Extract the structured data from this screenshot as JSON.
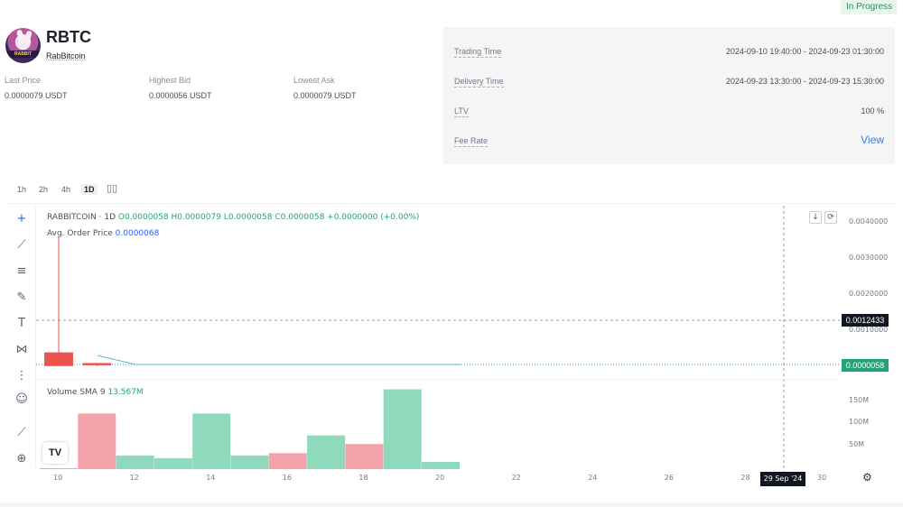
{
  "status": "In Progress",
  "token": {
    "symbol": "RBTC",
    "name": "RabBitcoin",
    "logo_icon": "rabbit-coin-logo",
    "logo_text": "RABBIT"
  },
  "stats": [
    {
      "label": "Last Price",
      "value": "0.0000079 USDT"
    },
    {
      "label": "Highest Bid",
      "value": "0.0000056 USDT"
    },
    {
      "label": "Lowest Ask",
      "value": "0.0000079 USDT"
    }
  ],
  "info": {
    "trading_time_label": "Trading Time",
    "trading_time_value": "2024-09-10 19:40:00 - 2024-09-23 01:30:00",
    "delivery_time_label": "Delivery Time",
    "delivery_time_value": "2024-09-23 13:30:00 - 2024-09-23 15:30:00",
    "ltv_label": "LTV",
    "ltv_value": "100 %",
    "fee_label": "Fee Rate",
    "fee_link": "View"
  },
  "timeframes": [
    "1h",
    "2h",
    "4h",
    "1D"
  ],
  "active_timeframe": "1D",
  "chart_type_icon": "candlestick-icon",
  "legend": {
    "symbol": "RABBITCOIN · 1D",
    "ohlc": "O0.0000058 H0.0000079 L0.0000058 C0.0000058 +0.0000000 (+0.00%)",
    "avg_label": "Avg. Order Price",
    "avg_value": "0.0000068",
    "volume_label": "Volume SMA 9",
    "volume_value": "13.567M"
  },
  "price_axis": [
    "0.0040000",
    "0.0030000",
    "0.0020000",
    "0.0010000"
  ],
  "crosshair_price": "0.0012433",
  "last_price_tag": "0.0000058",
  "volume_axis": [
    "150M",
    "100M",
    "50M"
  ],
  "date_axis": [
    "10",
    "12",
    "14",
    "16",
    "18",
    "20",
    "22",
    "24",
    "26",
    "28",
    "30"
  ],
  "crosshair_date": "29 Sep '24",
  "tv_logo": "TV",
  "colors": {
    "up": "#26a69a",
    "down": "#ef5350",
    "volume_up": "#8fd9bd",
    "volume_down": "#f5a3aa",
    "accent": "#3d7ce0"
  },
  "chart_data": {
    "type": "bar",
    "candles": [
      {
        "day": "2024-09-10",
        "open": 5.8e-06,
        "high": 0.004,
        "low": 5.8e-06,
        "close": 0.00043,
        "direction": "down"
      },
      {
        "day": "2024-09-11",
        "open": 0.0001,
        "high": 0.0001,
        "low": 7e-06,
        "close": 3e-05,
        "direction": "down"
      }
    ],
    "volume": {
      "categories": [
        "10",
        "11",
        "12",
        "13",
        "14",
        "15",
        "16",
        "17",
        "18",
        "19",
        "20"
      ],
      "values": [
        2,
        122,
        30,
        24,
        122,
        30,
        35,
        74,
        55,
        175,
        16
      ],
      "directions": [
        "down",
        "down",
        "up",
        "up",
        "up",
        "up",
        "down",
        "up",
        "down",
        "up",
        "up"
      ]
    },
    "ylim": [
      0,
      0.0045
    ],
    "volume_ylim": [
      0,
      190
    ]
  }
}
